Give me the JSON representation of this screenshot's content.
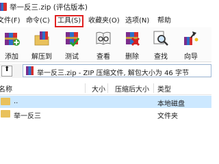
{
  "window": {
    "title": "举一反三.zip (评估版本)"
  },
  "menu": [
    {
      "label": "文件(F)"
    },
    {
      "label": "命令(C)"
    },
    {
      "label": "工具(S)"
    },
    {
      "label": "收藏夹(O)"
    },
    {
      "label": "选项(N)"
    },
    {
      "label": "帮助"
    }
  ],
  "toolbar": [
    {
      "label": "添加",
      "icon": "add-books-icon"
    },
    {
      "label": "解压到",
      "icon": "extract-to-icon"
    },
    {
      "label": "测试",
      "icon": "test-icon"
    },
    {
      "label": "查看",
      "icon": "view-icon"
    },
    {
      "label": "删除",
      "icon": "delete-icon"
    },
    {
      "label": "查找",
      "icon": "find-icon"
    },
    {
      "label": "向导",
      "icon": "wizard-icon"
    }
  ],
  "address": {
    "text": "举一反三.zip - ZIP 压缩文件, 解包大小为 46 字节"
  },
  "columns": {
    "name": "名称",
    "size": "大小",
    "packed": "压缩后大小",
    "type": "类型"
  },
  "rows": [
    {
      "name": "..",
      "size": "",
      "packed": "",
      "type": "本地磁盘",
      "selected": true
    },
    {
      "name": "举一反三",
      "size": "",
      "packed": "",
      "type": "文件夹",
      "selected": false
    }
  ],
  "colors": {
    "highlight_border": "#e02020",
    "selection": "#cce8ff",
    "folder": "#e9c15b"
  }
}
